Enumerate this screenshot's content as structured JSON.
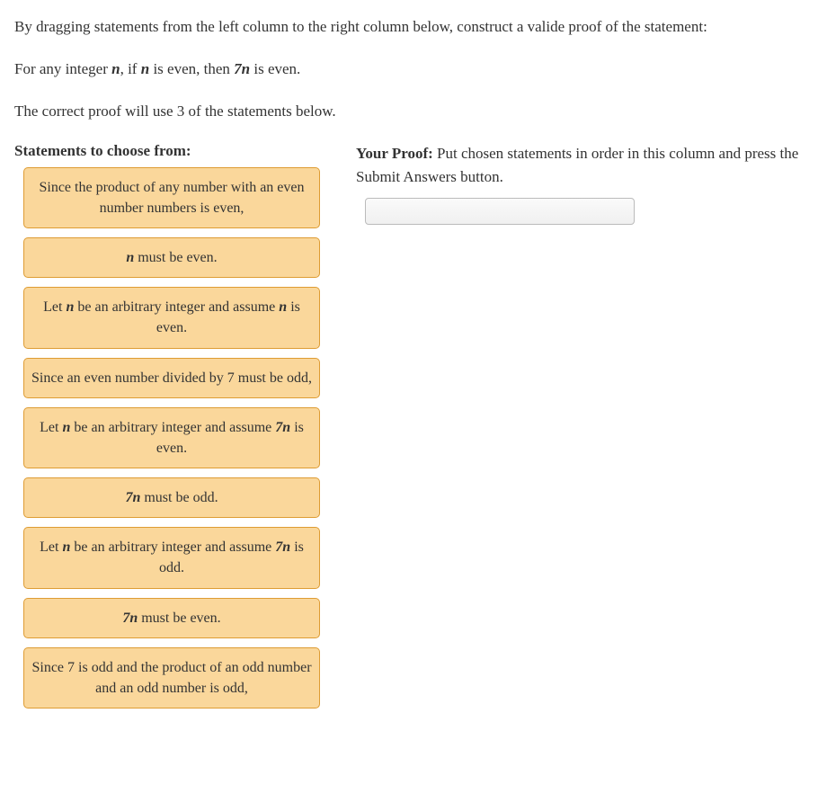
{
  "intro": {
    "p1_a": "By dragging statements from the left column to the right column below, construct a valide proof of the statement:",
    "p2_prefix": "For any integer ",
    "p2_var1": "n",
    "p2_mid1": ", if ",
    "p2_var2": "n",
    "p2_mid2": " is even, then ",
    "p2_var3": "7n",
    "p2_suffix": " is even.",
    "p3": "The correct proof will use 3 of the statements below."
  },
  "left_heading": "Statements to choose from:",
  "right_heading_lead": "Your Proof:",
  "right_heading_rest": " Put chosen statements in order in this column and press the Submit Answers button.",
  "statements": [
    {
      "a": "Since the product of any number with an even number numbers is even,",
      "b": "",
      "c": ""
    },
    {
      "a": "",
      "b": "n",
      "c": " must be even."
    },
    {
      "a": "Let ",
      "b": "n",
      "c": " be an arbitrary integer and assume ",
      "d": "n",
      "e": " is even."
    },
    {
      "a": "Since an even number divided by 7 must be odd,",
      "b": "",
      "c": ""
    },
    {
      "a": "Let ",
      "b": "n",
      "c": " be an arbitrary integer and assume ",
      "d": "7n",
      "e": " is even."
    },
    {
      "a": "",
      "b": "7n",
      "c": " must be odd."
    },
    {
      "a": "Let ",
      "b": "n",
      "c": " be an arbitrary integer and assume ",
      "d": "7n",
      "e": " is odd."
    },
    {
      "a": "",
      "b": "7n",
      "c": " must be even."
    },
    {
      "a": "Since 7 is odd and the product of an odd number and an odd number is odd,",
      "b": "",
      "c": ""
    }
  ]
}
